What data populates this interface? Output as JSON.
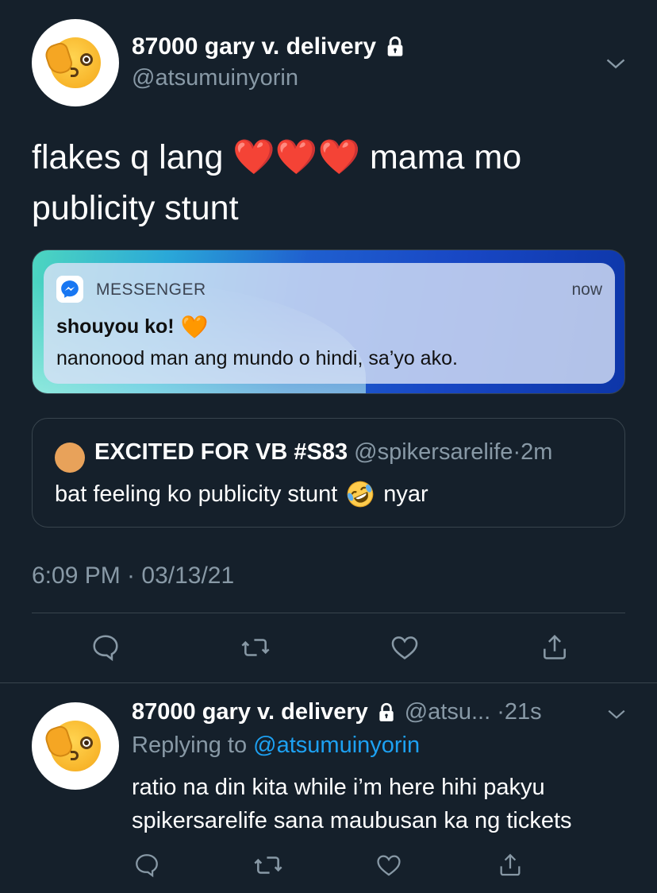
{
  "main_tweet": {
    "display_name": "87000 gary v. delivery",
    "handle": "@atsumuinyorin",
    "text_line1_before": "flakes q lang",
    "hearts": "❤️❤️❤️",
    "text_line1_after": "mama mo",
    "text_line2": "publicity stunt",
    "timestamp": "6:09 PM · 03/13/21"
  },
  "media": {
    "notification": {
      "app": "MESSENGER",
      "time": "now",
      "title": "shouyou ko!",
      "title_emoji": "🧡",
      "body": "nanonood man ang mundo o hindi, sa’yo ako."
    }
  },
  "quote_tweet": {
    "display_name": "EXCITED FOR VB #S83",
    "handle": "@spikersarelife",
    "separator": "·",
    "time": "2m",
    "text_before": "bat feeling ko publicity stunt",
    "text_after": "nyar",
    "avatar_color": "#e8a25a"
  },
  "reply_tweet": {
    "display_name": "87000 gary v. delivery",
    "handle": "@atsu...",
    "separator": "·",
    "time": "21s",
    "replying_prefix": "Replying to",
    "replying_mention": "@atsumuinyorin",
    "text": "ratio na din kita while i’m here hihi pakyu spikersarelife sana maubusan ka ng tickets"
  },
  "icons": {
    "lock": "lock-icon",
    "chevron": "chevron-down-icon",
    "reply": "reply-icon",
    "retweet": "retweet-icon",
    "like": "like-icon",
    "share": "share-icon"
  },
  "colors": {
    "background": "#15202b",
    "secondary_text": "#8899a6",
    "accent": "#1da1f2",
    "border": "#38444d"
  }
}
